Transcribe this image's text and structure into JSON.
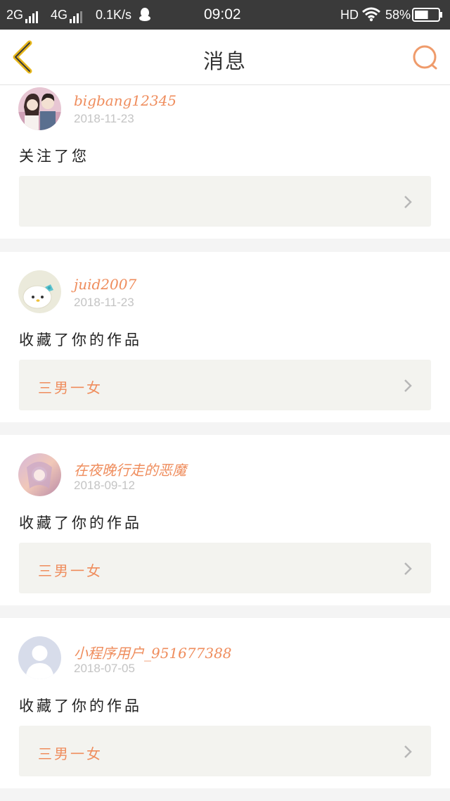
{
  "status_bar": {
    "left_signal_1": "2G",
    "left_signal_2": "4G",
    "speed": "0.1K/s",
    "time": "09:02",
    "hd": "HD",
    "battery": "58%",
    "battery_level": 0.58
  },
  "header": {
    "title": "消息",
    "back_icon": "chevron-left-icon",
    "search_icon": "search-icon"
  },
  "messages": [
    {
      "username": "bigbang12345",
      "date": "2018-11-23",
      "action": "关注了您",
      "work_title": ""
    },
    {
      "username": "juid2007",
      "date": "2018-11-23",
      "action": "收藏了你的作品",
      "work_title": "三男一女"
    },
    {
      "username": "在夜晚行走的恶魔",
      "date": "2018-09-12",
      "action": "收藏了你的作品",
      "work_title": "三男一女"
    },
    {
      "username": "小程序用户_951677388",
      "date": "2018-07-05",
      "action": "收藏了你的作品",
      "work_title": "三男一女"
    }
  ],
  "colors": {
    "accent": "#ef8d5d",
    "back_icon": "#e8b81c",
    "status_bar": "#3a3a3a",
    "page_bg": "#f4f4f4",
    "work_box": "#f3f3ef"
  }
}
